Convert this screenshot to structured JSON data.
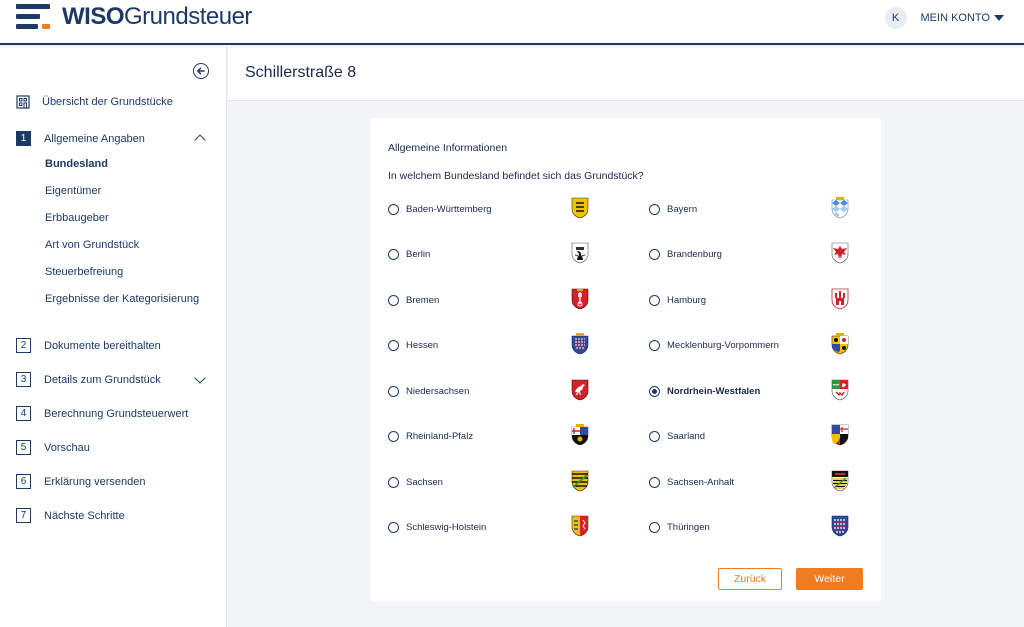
{
  "header": {
    "brand_bold": "WISO",
    "brand_rest": "Grundsteuer",
    "avatar_initial": "K",
    "account_label": "MEIN KONTO"
  },
  "sidebar": {
    "overview_label": "Übersicht der Grundstücke",
    "steps": [
      {
        "num": "1",
        "label": "Allgemeine Angaben",
        "active": true,
        "expanded": true
      },
      {
        "num": "2",
        "label": "Dokumente bereithalten"
      },
      {
        "num": "3",
        "label": "Details zum Grundstück",
        "expandable": true
      },
      {
        "num": "4",
        "label": "Berechnung Grundsteuerwert"
      },
      {
        "num": "5",
        "label": "Vorschau"
      },
      {
        "num": "6",
        "label": "Erklärung versenden"
      },
      {
        "num": "7",
        "label": "Nächste Schritte"
      }
    ],
    "substeps": [
      "Bundesland",
      "Eigentümer",
      "Erbbaugeber",
      "Art von Grundstück",
      "Steuerbefreiung",
      "Ergebnisse der Kategorisierung"
    ],
    "active_substep": "Bundesland"
  },
  "main": {
    "title": "Schillerstraße 8",
    "section_title": "Allgemeine Informationen",
    "question": "In welchem Bundesland befindet sich das Grundstück?",
    "options": [
      {
        "label": "Baden-Württemberg",
        "selected": false
      },
      {
        "label": "Bayern",
        "selected": false
      },
      {
        "label": "Berlin",
        "selected": false
      },
      {
        "label": "Brandenburg",
        "selected": false
      },
      {
        "label": "Bremen",
        "selected": false
      },
      {
        "label": "Hamburg",
        "selected": false
      },
      {
        "label": "Hessen",
        "selected": false
      },
      {
        "label": "Mecklenburg-Vorpommern",
        "selected": false
      },
      {
        "label": "Niedersachsen",
        "selected": false
      },
      {
        "label": "Nordrhein-Westfalen",
        "selected": true
      },
      {
        "label": "Rheinland-Pfalz",
        "selected": false
      },
      {
        "label": "Saarland",
        "selected": false
      },
      {
        "label": "Sachsen",
        "selected": false
      },
      {
        "label": "Sachsen-Anhalt",
        "selected": false
      },
      {
        "label": "Schleswig-Holstein",
        "selected": false
      },
      {
        "label": "Thüringen",
        "selected": false
      }
    ],
    "back_label": "Zurück",
    "next_label": "Weiter"
  },
  "colors": {
    "navy": "#1d3a66",
    "accent_orange": "#f07c22",
    "background": "#f4f5f7"
  }
}
